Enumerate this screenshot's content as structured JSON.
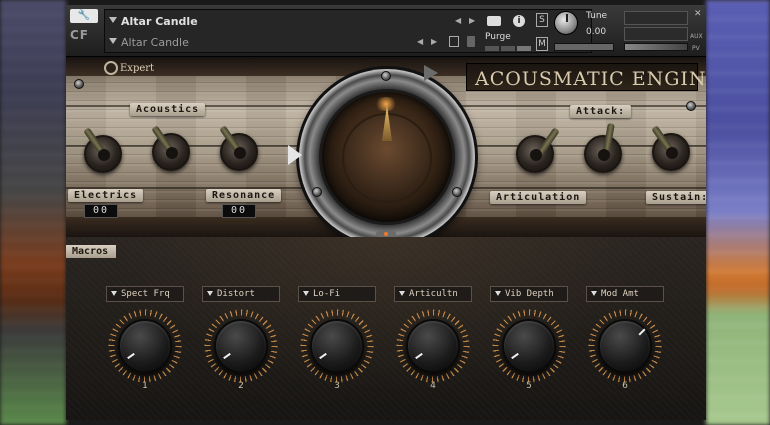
{
  "header": {
    "instrument_name": "Altar Candle",
    "preset_name": "Altar Candle",
    "purge_label": "Purge",
    "tune_label": "Tune",
    "tune_value": "0.00",
    "solo_label": "S",
    "mute_label": "M",
    "logo_text": "CF",
    "close_label": "✕",
    "aux_label": "AUX",
    "pv_label": "PV",
    "arrow_left": "◀",
    "arrow_right": "▶",
    "info_label": "i"
  },
  "engine": {
    "expert_label": "Expert",
    "title": "ACOUSMATIC ENGINE",
    "acoustics_label": "Acoustics",
    "attack_label": "Attack:",
    "electrics_label": "Electrics",
    "electrics_value": "00",
    "resonance_label": "Resonance",
    "resonance_value": "00",
    "articulation_label": "Articulation",
    "sustain_label": "Sustain:"
  },
  "macros": {
    "label": "Macros",
    "slots": [
      {
        "label": "Spect Frq",
        "number": "1"
      },
      {
        "label": "Distort",
        "number": "2"
      },
      {
        "label": "Lo-Fi",
        "number": "3"
      },
      {
        "label": "Articultn",
        "number": "4"
      },
      {
        "label": "Vib Depth",
        "number": "5"
      },
      {
        "label": "Mod Amt",
        "number": "6"
      }
    ]
  },
  "icons": {
    "wrench": "wrench-icon",
    "camera": "camera-icon",
    "info": "info-icon",
    "save": "save-icon",
    "delete": "trash-icon",
    "gear": "gear-icon"
  }
}
